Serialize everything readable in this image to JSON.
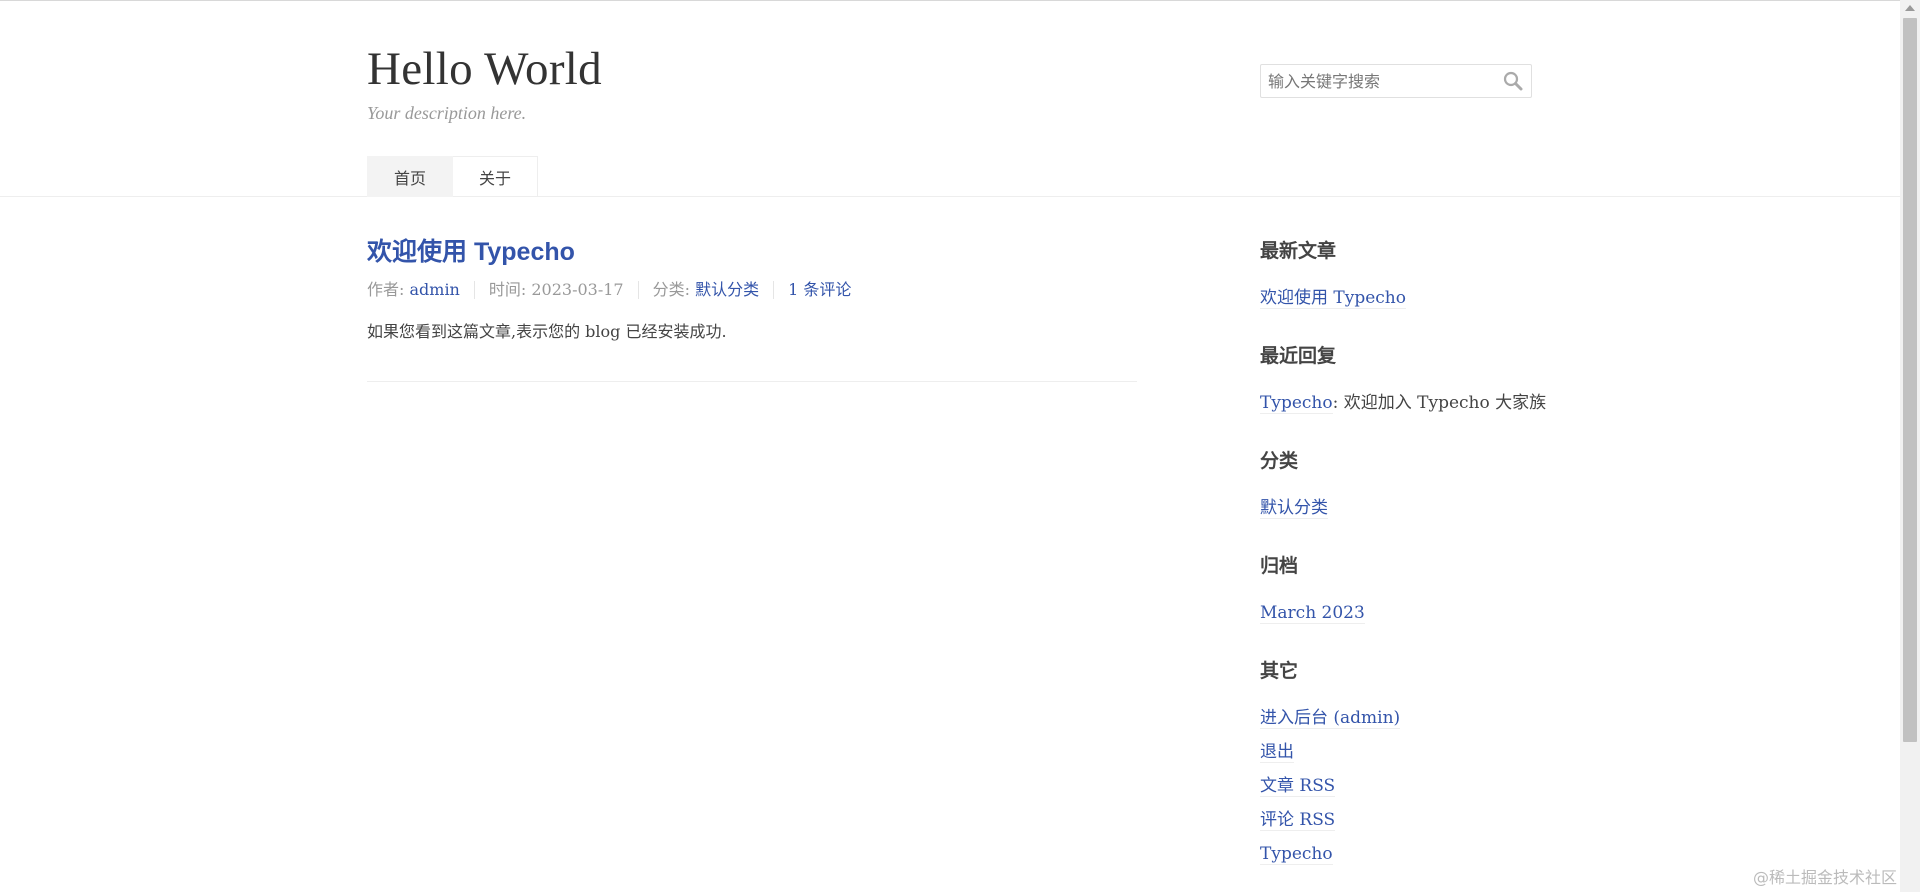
{
  "header": {
    "site_title": "Hello World",
    "site_description": "Your description here.",
    "search_placeholder": "输入关键字搜索",
    "search_icon": "magnifier-icon"
  },
  "nav": {
    "items": [
      {
        "label": "首页",
        "active": true
      },
      {
        "label": "关于",
        "active": false
      }
    ]
  },
  "post": {
    "title": "欢迎使用 Typecho",
    "author_label": "作者: ",
    "author": "admin",
    "time_label": "时间: ",
    "time": "2023-03-17",
    "category_label": "分类: ",
    "category": "默认分类",
    "comments": "1 条评论",
    "content": "如果您看到这篇文章,表示您的 blog 已经安装成功."
  },
  "sidebar": {
    "recent_posts": {
      "title": "最新文章",
      "items": [
        "欢迎使用 Typecho"
      ]
    },
    "recent_comments": {
      "title": "最近回复",
      "author": "Typecho",
      "text": ": 欢迎加入 Typecho 大家族"
    },
    "categories": {
      "title": "分类",
      "items": [
        "默认分类"
      ]
    },
    "archives": {
      "title": "归档",
      "items": [
        "March 2023"
      ]
    },
    "misc": {
      "title": "其它",
      "items": [
        "进入后台 (admin)",
        "退出",
        "文章 RSS",
        "评论 RSS",
        "Typecho"
      ]
    }
  },
  "watermark": "@稀土掘金技术社区",
  "colors": {
    "link": "#3354aa",
    "text": "#444444",
    "muted": "#999999"
  }
}
